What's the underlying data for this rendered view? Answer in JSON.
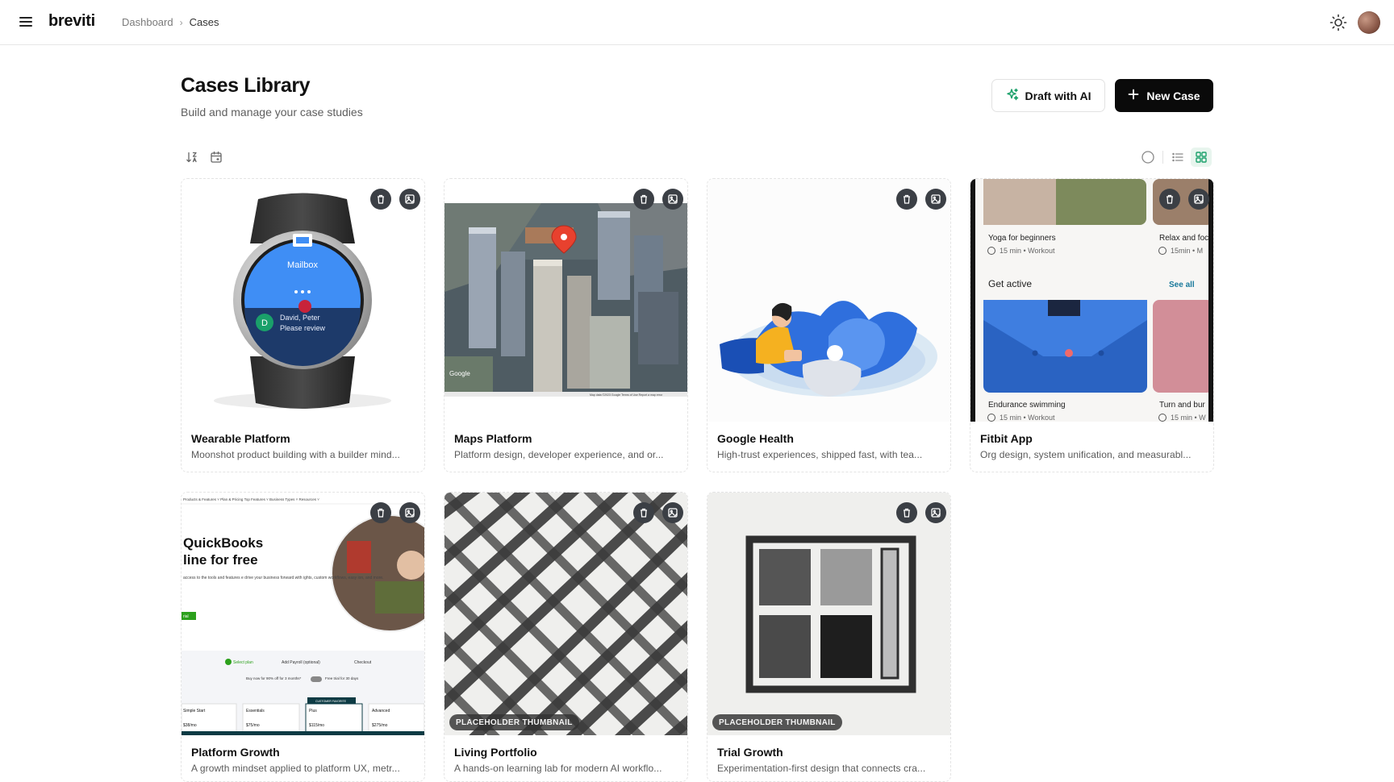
{
  "app": {
    "name": "breviti"
  },
  "breadcrumb": {
    "items": [
      "Dashboard",
      "Cases"
    ]
  },
  "header": {
    "title": "Cases Library",
    "subtitle": "Build and manage your case studies",
    "draft_ai_label": "Draft with AI",
    "new_case_label": "New Case"
  },
  "colors": {
    "accent_green": "#1aa06a",
    "primary_black": "#0a0a0a"
  },
  "toolbar": {
    "left_icons": [
      "sort-icon",
      "calendar-icon"
    ],
    "view_icons": [
      "circle-icon",
      "list-view-icon",
      "grid-view-icon"
    ],
    "active_view": "grid"
  },
  "cards": [
    {
      "title": "Wearable Platform",
      "description": "Moonshot product building with a builder mind...",
      "thumb_text": {
        "app": "Mailbox",
        "sender": "David, Peter",
        "preview": "Please review",
        "initial": "D"
      }
    },
    {
      "title": "Maps Platform",
      "description": "Platform design, developer experience, and or...",
      "thumb_text": {
        "watermark": "Google",
        "footer": "Map data ©2023 Google   Terms of Use   Report a map error"
      }
    },
    {
      "title": "Google Health",
      "description": "High-trust experiences, shipped fast, with tea..."
    },
    {
      "title": "Fitbit App",
      "description": "Org design, system unification, and measurabl...",
      "thumb_text": {
        "item1": "Yoga for beginners",
        "item1_meta": "15 min • Workout",
        "item2": "Relax and foc",
        "item2_meta": "15min • M",
        "section": "Get active",
        "see_all": "See all",
        "item3": "Endurance swimming",
        "item3_meta": "15 min • Workout",
        "item4": "Turn and bur",
        "item4_meta": "15 min • W"
      }
    },
    {
      "title": "Platform Growth",
      "description": "A growth mindset applied to platform UX, metr...",
      "thumb_text": {
        "nav": "Products & Features ˅   Plan & Pricing   Top Features ˅   Business Types ˅   Resources ˅",
        "headline1": "QuickBooks",
        "headline2": "line for free",
        "body": "access to the tools and features\ne drive your business forward with\nights, custom workflows, easy\nion, and more.",
        "cta": "rial",
        "step1": "Select plan",
        "step2": "Add Payroll (optional)",
        "step3": "Checkout",
        "promo": "Buy now for 90% off for 3 months*",
        "trial": "Free trial for 30 days",
        "plans": [
          "Simple Start",
          "Essentials",
          "Plus",
          "Advanced"
        ],
        "prices": [
          "$38/mo",
          "$75/mo",
          "$115/mo",
          "$275/mo"
        ],
        "badge": "CUSTOMER FAVORITE"
      }
    },
    {
      "title": "Living Portfolio",
      "description": "A hands-on learning lab for modern AI workflo...",
      "badge": "PLACEHOLDER THUMBNAIL"
    },
    {
      "title": "Trial Growth",
      "description": "Experimentation-first design that connects cra...",
      "badge": "PLACEHOLDER THUMBNAIL"
    }
  ]
}
